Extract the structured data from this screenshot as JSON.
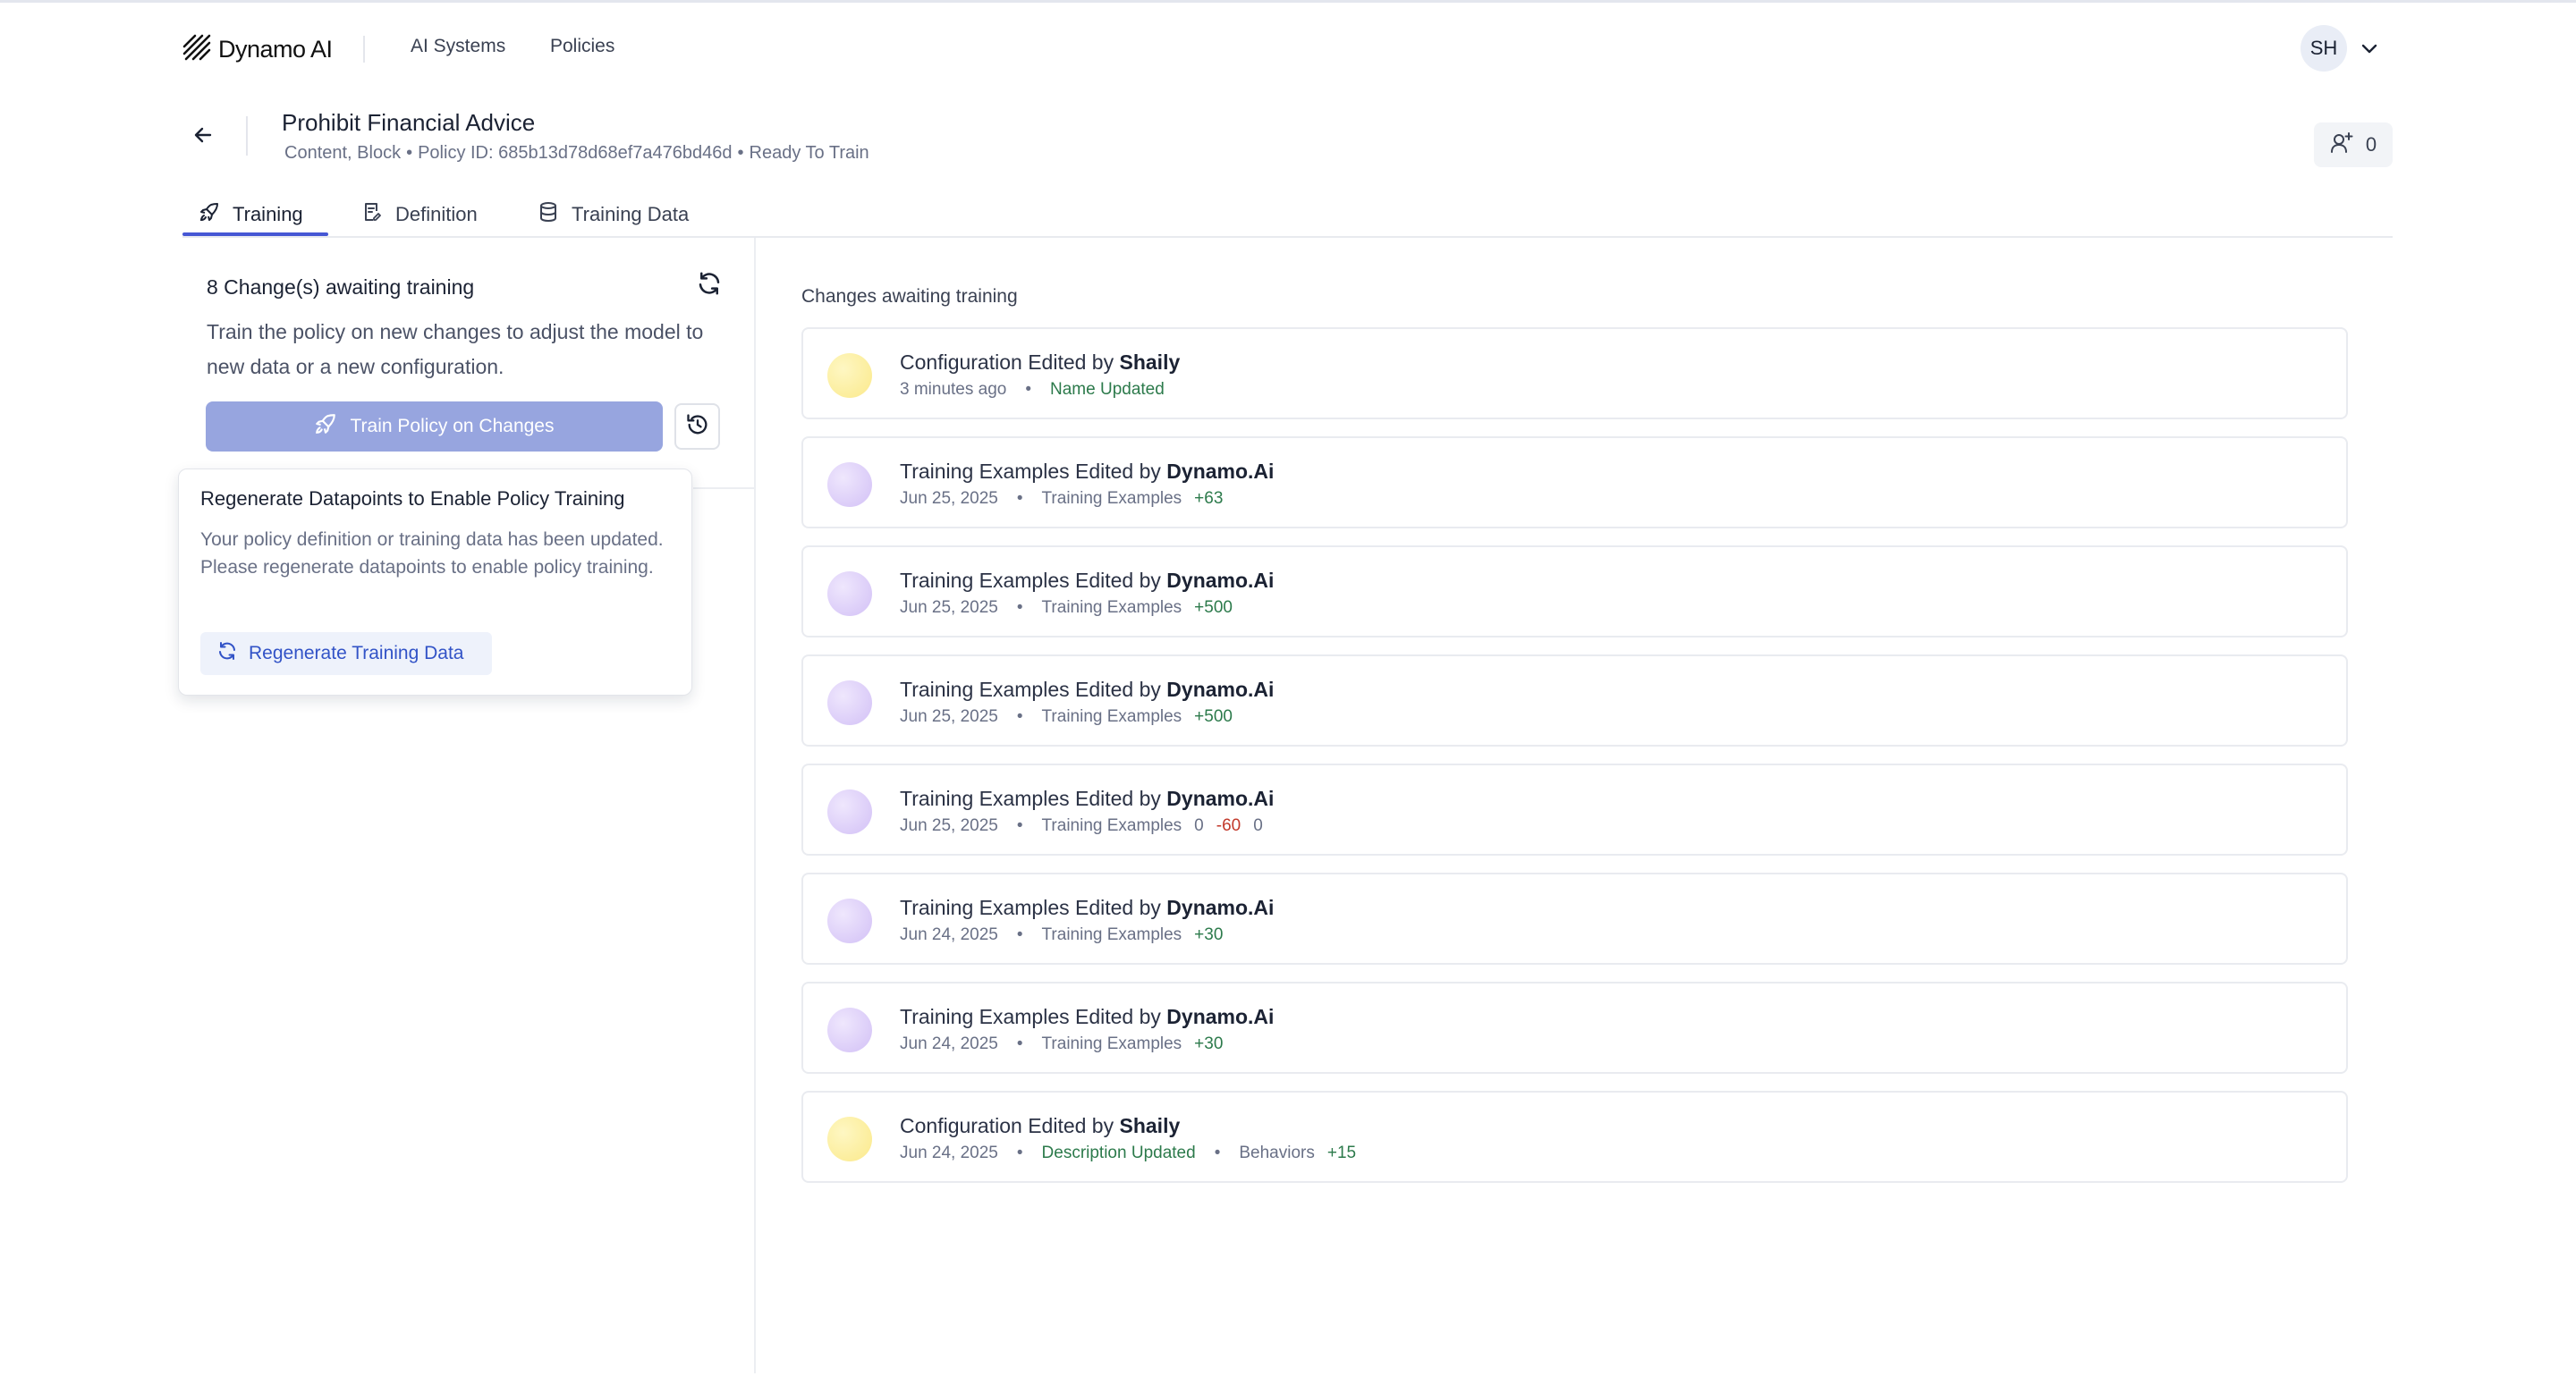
{
  "brand": {
    "name": "Dynamo AI"
  },
  "nav": {
    "items": [
      "AI Systems",
      "Policies"
    ]
  },
  "user": {
    "initials": "SH"
  },
  "policy": {
    "title": "Prohibit Financial Advice",
    "meta": [
      "Content, Block",
      "Policy ID: 685b13d78d68ef7a476bd46d",
      "Ready To Train"
    ],
    "share_count": "0"
  },
  "tabs": [
    {
      "label": "Training",
      "icon": "rocket-icon",
      "active": true
    },
    {
      "label": "Definition",
      "icon": "document-edit-icon",
      "active": false
    },
    {
      "label": "Training Data",
      "icon": "database-icon",
      "active": false
    }
  ],
  "left_panel": {
    "title": "8 Change(s) awaiting training",
    "description": "Train the policy on new changes to adjust the model to new data or a new configuration.",
    "train_button": "Train Policy on Changes"
  },
  "popover": {
    "title": "Regenerate Datapoints to Enable Policy Training",
    "body": "Your policy definition or training data has been updated. Please regenerate datapoints to enable policy training.",
    "button": "Regenerate Training Data"
  },
  "changes_heading": "Changes awaiting training",
  "changes": [
    {
      "prefix": "Configuration Edited by",
      "author": "Shaily",
      "avatar": "yellow",
      "date": "3 minutes ago",
      "details": [
        {
          "label": "Name Updated",
          "style": "green"
        }
      ]
    },
    {
      "prefix": "Training Examples Edited by",
      "author": "Dynamo.Ai",
      "avatar": "purple",
      "date": "Jun 25, 2025",
      "details": [
        {
          "label": "Training Examples",
          "deltas": [
            {
              "v": "+63",
              "t": "pos"
            }
          ]
        }
      ]
    },
    {
      "prefix": "Training Examples Edited by",
      "author": "Dynamo.Ai",
      "avatar": "purple",
      "date": "Jun 25, 2025",
      "details": [
        {
          "label": "Training Examples",
          "deltas": [
            {
              "v": "+500",
              "t": "pos"
            }
          ]
        }
      ]
    },
    {
      "prefix": "Training Examples Edited by",
      "author": "Dynamo.Ai",
      "avatar": "purple",
      "date": "Jun 25, 2025",
      "details": [
        {
          "label": "Training Examples",
          "deltas": [
            {
              "v": "+500",
              "t": "pos"
            }
          ]
        }
      ]
    },
    {
      "prefix": "Training Examples Edited by",
      "author": "Dynamo.Ai",
      "avatar": "purple",
      "date": "Jun 25, 2025",
      "details": [
        {
          "label": "Training Examples",
          "deltas": [
            {
              "v": "0",
              "t": "neutral"
            },
            {
              "v": "-60",
              "t": "neg"
            },
            {
              "v": "0",
              "t": "neutral"
            }
          ]
        }
      ]
    },
    {
      "prefix": "Training Examples Edited by",
      "author": "Dynamo.Ai",
      "avatar": "purple",
      "date": "Jun 24, 2025",
      "details": [
        {
          "label": "Training Examples",
          "deltas": [
            {
              "v": "+30",
              "t": "pos"
            }
          ]
        }
      ]
    },
    {
      "prefix": "Training Examples Edited by",
      "author": "Dynamo.Ai",
      "avatar": "purple",
      "date": "Jun 24, 2025",
      "details": [
        {
          "label": "Training Examples",
          "deltas": [
            {
              "v": "+30",
              "t": "pos"
            }
          ]
        }
      ]
    },
    {
      "prefix": "Configuration Edited by",
      "author": "Shaily",
      "avatar": "yellow",
      "date": "Jun 24, 2025",
      "details": [
        {
          "label": "Description Updated",
          "style": "green"
        },
        {
          "label": "Behaviors",
          "deltas": [
            {
              "v": "+15",
              "t": "pos"
            }
          ]
        }
      ]
    }
  ],
  "colors": {
    "accent": "#4657d4",
    "train_button": "#97a5df",
    "positive": "#2c7a4b",
    "negative": "#c2392b"
  }
}
